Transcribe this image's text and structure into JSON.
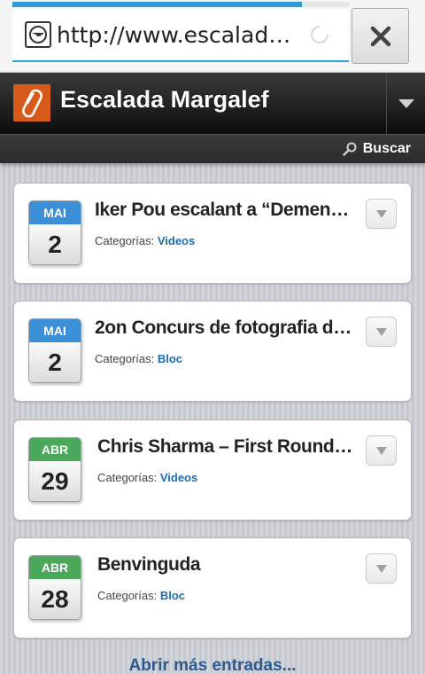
{
  "browser": {
    "url": "http://www.escalada...",
    "load_progress": 0.86,
    "site_icon": "globe-icon",
    "close_icon": "close-icon"
  },
  "site": {
    "title": "Escalada Margalef",
    "logo_icon": "carabiner-logo",
    "menu_icon": "chevron-down-icon",
    "accent_color": "#d75a1b"
  },
  "search": {
    "label": "Buscar",
    "icon": "search-icon"
  },
  "posts": [
    {
      "month": "MAI",
      "day": "2",
      "title": "Iker Pou escalant a “Demencia...",
      "category_label": "Categorías: ",
      "category": "Videos",
      "month_color": "#3a8fd6"
    },
    {
      "month": "MAI",
      "day": "2",
      "title": "2on Concurs de fotografia de ...",
      "category_label": "Categorías: ",
      "category": "Bloc",
      "month_color": "#3a8fd6"
    },
    {
      "month": "ABR",
      "day": "29",
      "title": "Chris Sharma – First Round Fi...",
      "category_label": "Categorías: ",
      "category": "Videos",
      "month_color": "#4aa85a"
    },
    {
      "month": "ABR",
      "day": "28",
      "title": "Benvinguda",
      "category_label": "Categorías: ",
      "category": "Bloc",
      "month_color": "#4aa85a"
    }
  ],
  "load_more_label": "Abrir más entradas..."
}
